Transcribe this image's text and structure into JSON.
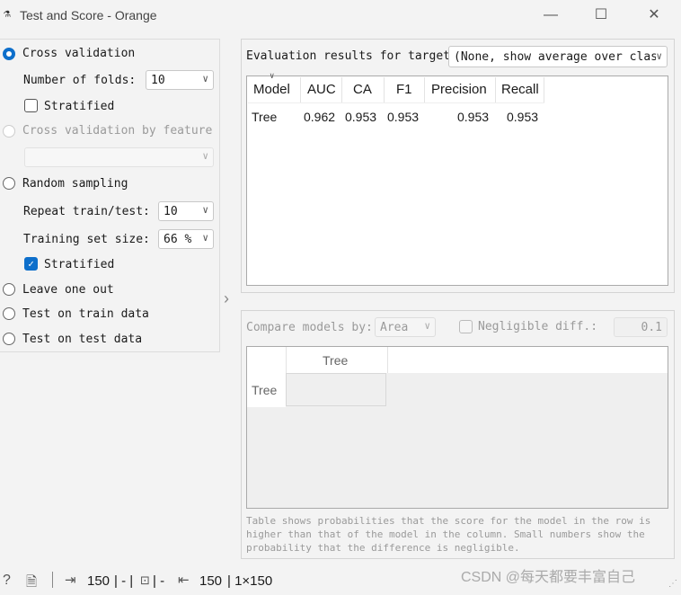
{
  "window": {
    "title": "Test and Score - Orange",
    "buttons": {
      "minimize": "—",
      "maximize": "☐",
      "close": "✕"
    }
  },
  "sampling": {
    "cross_validation": {
      "label": "Cross validation",
      "selected": true
    },
    "folds": {
      "label": "Number of folds:",
      "value": "10"
    },
    "stratified_cv": {
      "label": "Stratified",
      "checked": false
    },
    "cv_by_feature": {
      "label": "Cross validation by feature",
      "enabled": false
    },
    "random_sampling": {
      "label": "Random sampling"
    },
    "repeat": {
      "label": "Repeat train/test:",
      "value": "10"
    },
    "train_size": {
      "label": "Training set size:",
      "value": "66 %"
    },
    "stratified_rs": {
      "label": "Stratified",
      "checked": true
    },
    "leave_one_out": {
      "label": "Leave one out"
    },
    "test_on_train": {
      "label": "Test on train data"
    },
    "test_on_test": {
      "label": "Test on test data"
    }
  },
  "evaluation": {
    "label": "Evaluation results for target",
    "target": "(None, show average over clas",
    "columns": [
      "Model",
      "AUC",
      "CA",
      "F1",
      "Precision",
      "Recall"
    ],
    "rows": [
      {
        "model": "Tree",
        "auc": "0.962",
        "ca": "0.953",
        "f1": "0.953",
        "precision": "0.953",
        "recall": "0.953"
      }
    ]
  },
  "compare": {
    "label": "Compare models by:",
    "metric": "Area",
    "negligible_label": "Negligible diff.:",
    "negligible_value": "0.1",
    "col_header": "Tree",
    "row_header": "Tree",
    "note": "Table shows probabilities that the score for the model in the row is higher than that of the model in the column. Small numbers show the probability that the difference is negligible."
  },
  "status": {
    "input_count": "150",
    "input_sep": "| - |",
    "sep2": "| -",
    "output_count": "150",
    "output_shape": "| 1×150"
  },
  "watermark": "CSDN @每天都要丰富自己"
}
